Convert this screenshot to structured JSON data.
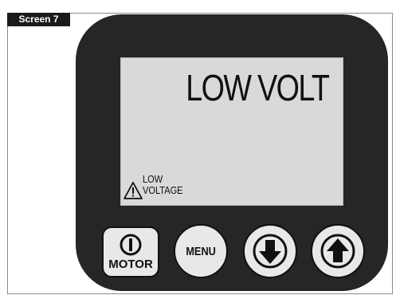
{
  "header": {
    "screen_label": "Screen 7"
  },
  "display": {
    "main_text": "LOW VOLT",
    "warning_line1": "LOW",
    "warning_line2": "VOLTAGE"
  },
  "buttons": {
    "motor_label": "MOTOR",
    "menu_label": "MENU"
  },
  "icons": [
    "warning-triangle-icon",
    "power-icon",
    "down-arrow-icon",
    "up-arrow-icon"
  ],
  "colors": {
    "device_body": "#262626",
    "lcd_background": "#d9d9d9",
    "button_face": "#e8e8e8"
  }
}
